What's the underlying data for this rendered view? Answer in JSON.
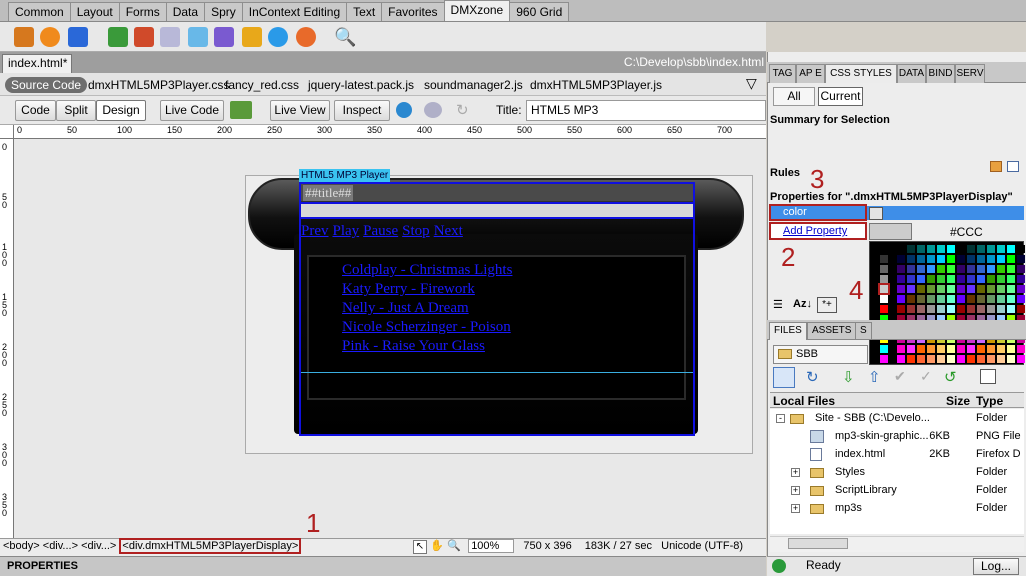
{
  "insert_tabs": [
    "Common",
    "Layout",
    "Forms",
    "Data",
    "Spry",
    "InContext Editing",
    "Text",
    "Favorites",
    "DMXzone",
    "960 Grid"
  ],
  "document": {
    "tab": "index.html*",
    "path": "C:\\Develop\\sbb\\index.html",
    "source_code": "Source Code",
    "related_files": [
      "dmxHTML5MP3Player.css",
      "fancy_red.css",
      "jquery-latest.pack.js",
      "soundmanager2.js",
      "dmxHTML5MP3Player.js"
    ]
  },
  "doc_toolbar": {
    "code": "Code",
    "split": "Split",
    "design": "Design",
    "live_code": "Live Code",
    "live_view": "Live View",
    "inspect": "Inspect",
    "title_label": "Title:",
    "title_value": "HTML5 MP3"
  },
  "ruler_labels": [
    "0",
    "50",
    "100",
    "150",
    "200",
    "250",
    "300",
    "350",
    "400",
    "450",
    "500",
    "550",
    "600",
    "650",
    "700"
  ],
  "vruler_labels": [
    "0",
    "50",
    "100",
    "150",
    "200",
    "250",
    "300",
    "350"
  ],
  "design": {
    "selection_label": "HTML5 MP3 Player",
    "title_placeholder": "##title##",
    "controls": [
      "Prev",
      "Play",
      "Pause",
      "Stop",
      "Next"
    ],
    "songs": [
      "Coldplay - Christmas Lights",
      "Katy Perry - Firework",
      "Nelly - Just A Dream",
      "Nicole Scherzinger - Poison",
      "Pink - Raise Your Glass"
    ]
  },
  "status": {
    "tags": [
      "<body>",
      "<div...>",
      "<div...>"
    ],
    "selected_tag": "<div.dmxHTML5MP3PlayerDisplay>",
    "zoom": "100%",
    "window_size": "750 x 396",
    "download": "183K / 27 sec",
    "encoding": "Unicode (UTF-8)"
  },
  "properties_label": "PROPERTIES",
  "panel": {
    "tabs": [
      "TAG",
      "AP E",
      "CSS STYLES",
      "DATA",
      "BIND",
      "SERV"
    ],
    "all": "All",
    "current": "Current",
    "summary": "Summary for Selection",
    "rules": "Rules",
    "props_for": "Properties for \".dmxHTML5MP3PlayerDisplay\"",
    "prop_name": "color",
    "add_property": "Add Property",
    "color_value": "#CCC",
    "az": "Az↓",
    "files_tabs": [
      "FILES",
      "ASSETS",
      "S"
    ],
    "site": "SBB",
    "local_files": "Local Files",
    "size_col": "Size",
    "type_col": "Type",
    "files": [
      {
        "name": "Site - SBB (C:\\Develo...",
        "size": "",
        "type": "Folder"
      },
      {
        "name": "mp3-skin-graphic...",
        "size": "6KB",
        "type": "PNG File"
      },
      {
        "name": "index.html",
        "size": "2KB",
        "type": "Firefox D"
      },
      {
        "name": "Styles",
        "size": "",
        "type": "Folder"
      },
      {
        "name": "ScriptLibrary",
        "size": "",
        "type": "Folder"
      },
      {
        "name": "mp3s",
        "size": "",
        "type": "Folder"
      }
    ],
    "ready": "Ready",
    "log": "Log..."
  },
  "annotations": [
    "1",
    "2",
    "3",
    "4"
  ],
  "colors": {
    "accent_red": "#b02020",
    "selection_blue": "#1010e0",
    "prop_blue": "#3e8ee8"
  }
}
